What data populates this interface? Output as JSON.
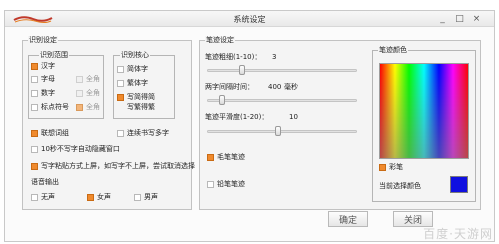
{
  "window": {
    "title": "系统设定",
    "controls": {
      "minimize": "_",
      "restore": "□",
      "close": "×"
    }
  },
  "recognition": {
    "legend": "识别设定",
    "range": {
      "legend": "识别范围",
      "options": [
        {
          "label": "汉字",
          "checked": true,
          "enabled": true
        },
        {
          "label": "字母",
          "checked": false,
          "enabled": true
        },
        {
          "label": "数字",
          "checked": false,
          "enabled": true
        },
        {
          "label": "标点符号",
          "checked": false,
          "enabled": true
        }
      ],
      "fullwidth": [
        {
          "label": "全角",
          "checked": false,
          "enabled": false
        },
        {
          "label": "全角",
          "checked": false,
          "enabled": false
        },
        {
          "label": "全角",
          "checked": true,
          "enabled": false
        }
      ]
    },
    "core": {
      "legend": "识别核心",
      "options": [
        {
          "label": "简体字",
          "checked": false
        },
        {
          "label": "繁体字",
          "checked": false
        },
        {
          "label": "写简得简",
          "checked": true
        }
      ],
      "sublabel": "写繁得繁"
    },
    "association": {
      "label": "联想词组",
      "checked": true
    },
    "continuous": {
      "label": "连续书写多字",
      "checked": false
    },
    "auto_hide": {
      "label": "10秒不写字自动隐藏窗口",
      "checked": false
    },
    "paste_mode": {
      "label": "写字粘贴方式上屏，如写字不上屏，尝试取消选择",
      "checked": true
    },
    "voice": {
      "label": "语音输出",
      "options": [
        {
          "label": "无声",
          "checked": false
        },
        {
          "label": "女声",
          "checked": true
        },
        {
          "label": "男声",
          "checked": false
        }
      ]
    }
  },
  "pen": {
    "legend": "笔迹设定",
    "thickness": {
      "label": "笔迹粗细(1-10)：",
      "value": "3",
      "fraction": 0.22
    },
    "delay": {
      "label": "两字间隔时间：",
      "value": "400",
      "unit": "毫秒",
      "fraction": 0.08
    },
    "smooth": {
      "label": "笔迹平滑度(1-20)：",
      "value": "10",
      "fraction": 0.47
    },
    "brush": {
      "label": "毛笔笔迹",
      "checked": true
    },
    "outline": {
      "label": "铅笔笔迹",
      "checked": false
    }
  },
  "color": {
    "legend": "笔迹颜色",
    "rainbow": {
      "label": "彩笔",
      "checked": true
    },
    "current_label": "当前选择颜色",
    "current_color": "#1010e0"
  },
  "buttons": {
    "ok": "确定",
    "close": "关闭"
  },
  "watermark": "百度·天游网"
}
